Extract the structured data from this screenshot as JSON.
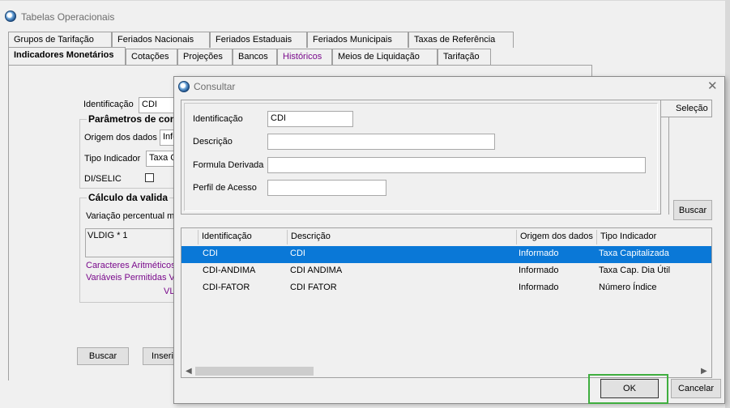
{
  "main_window": {
    "title": "Tabelas Operacionais",
    "tabs_row1": [
      "Grupos de Tarifação",
      "Feriados Nacionais",
      "Feriados Estaduais",
      "Feriados Municipais",
      "Taxas de Referência"
    ],
    "tabs_row2": [
      "Indicadores Monetários",
      "Cotações",
      "Projeções",
      "Bancos",
      "Históricos",
      "Meios de Liquidação",
      "Tarifação"
    ],
    "form": {
      "identificacao_label": "Identificação",
      "identificacao_value": "CDI",
      "params_group": "Parâmetros de con",
      "origem_label": "Origem dos dados",
      "origem_value": "Info",
      "tipo_label": "Tipo Indicador",
      "tipo_value": "Taxa C",
      "diselic_label": "DI/SELIC",
      "calc_group": "Cálculo da valida",
      "variacao_label": "Variação percentual ma",
      "formula_value": "VLDIG * 1",
      "caracteres_label": "Caracteres Aritméticos",
      "variaveis_label": "Variáveis Permitidas VL",
      "vl_label": "VL",
      "buscar_button": "Buscar",
      "inserir_button": "Inserir"
    }
  },
  "dialog": {
    "title": "Consultar",
    "close_glyph": "✕",
    "selecao_tab": "Seleção",
    "fields": {
      "identificacao_label": "Identificação",
      "identificacao_value": "CDI",
      "descricao_label": "Descrição",
      "descricao_value": "",
      "formula_label": "Formula Derivada",
      "formula_value": "",
      "perfil_label": "Perfil de Acesso",
      "perfil_value": ""
    },
    "buscar_button": "Buscar",
    "grid": {
      "columns": [
        "Identificação",
        "Descrição",
        "Origem dos dados",
        "Tipo Indicador"
      ],
      "rows": [
        [
          "CDI",
          "CDI",
          "Informado",
          "Taxa Capitalizada"
        ],
        [
          "CDI-ANDIMA",
          "CDI ANDIMA",
          "Informado",
          "Taxa Cap. Dia Útil"
        ],
        [
          "CDI-FATOR",
          "CDI FATOR",
          "Informado",
          "Número Índice"
        ]
      ],
      "selected_row": 0
    },
    "ok_button": "OK",
    "cancelar_button": "Cancelar",
    "colors": {
      "selection": "#0a78d7",
      "ok_highlight": "#3fae3f"
    }
  }
}
